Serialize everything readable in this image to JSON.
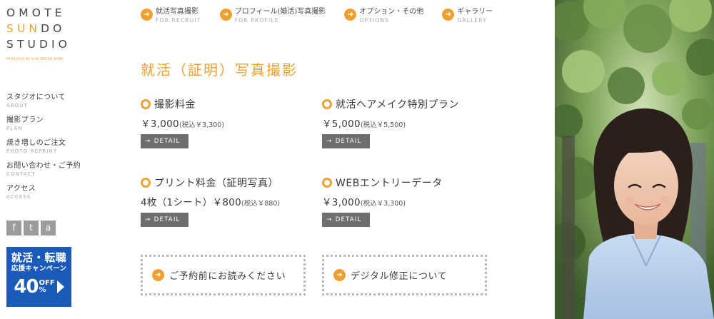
{
  "logo": {
    "line1": "OMOTE",
    "line2_accent": "SUN",
    "line2_rest": "DO",
    "line3": "STUDIO",
    "sub": "PRODUCED BY SUN DESIGN WORK"
  },
  "sidebar": {
    "items": [
      {
        "jp": "スタジオについて",
        "en": "ABOUT"
      },
      {
        "jp": "撮影プラン",
        "en": "PLAN"
      },
      {
        "jp": "焼き増しのご注文",
        "en": "PHOTO REPRINT"
      },
      {
        "jp": "お問い合わせ・ご予約",
        "en": "CONTACT"
      },
      {
        "jp": "アクセス",
        "en": "ACCESS"
      }
    ],
    "social": [
      "f",
      "t",
      "a"
    ],
    "campaign": {
      "line1": "就活・転職",
      "line2": "応援キャンペーン",
      "percent": "40",
      "off1": "OFF",
      "off2": "%"
    }
  },
  "topnav": {
    "items": [
      {
        "jp": "就活写真撮影",
        "en": "FOR RECRUIT",
        "icon": "arrow-right-icon"
      },
      {
        "jp": "プロフィール(婚活)写真撮影",
        "en": "FOR PROFILE",
        "icon": "arrow-right-icon"
      },
      {
        "jp": "オプション・その他",
        "en": "OPTIONS",
        "icon": "arrow-right-icon"
      },
      {
        "jp": "ギャラリー",
        "en": "GALLERY",
        "icon": "arrow-right-icon"
      }
    ]
  },
  "main": {
    "title": "就活（証明）写真撮影",
    "plans": [
      {
        "name": "撮影料金",
        "price": "￥3,000",
        "tax": "(税込￥3,300)",
        "button": "DETAIL"
      },
      {
        "name": "就活ヘアメイク特別プラン",
        "price": "￥5,000",
        "tax": "(税込￥5,500)",
        "button": "DETAIL"
      },
      {
        "name": "プリント料金（証明写真）",
        "price": "4枚（1シート）￥800",
        "tax": "(税込￥880)",
        "button": "DETAIL"
      },
      {
        "name": "WEBエントリーデータ",
        "price": "￥3,000",
        "tax": "(税込￥3,300)",
        "button": "DETAIL"
      }
    ],
    "banners": [
      {
        "label": "ご予約前にお読みください"
      },
      {
        "label": "デジタル修正について"
      }
    ]
  },
  "colors": {
    "accent": "#f0a030",
    "text": "#3a3a3a",
    "muted": "#a8a8a8",
    "button": "#6e6e6e",
    "campaign": "#1a5ab8"
  }
}
